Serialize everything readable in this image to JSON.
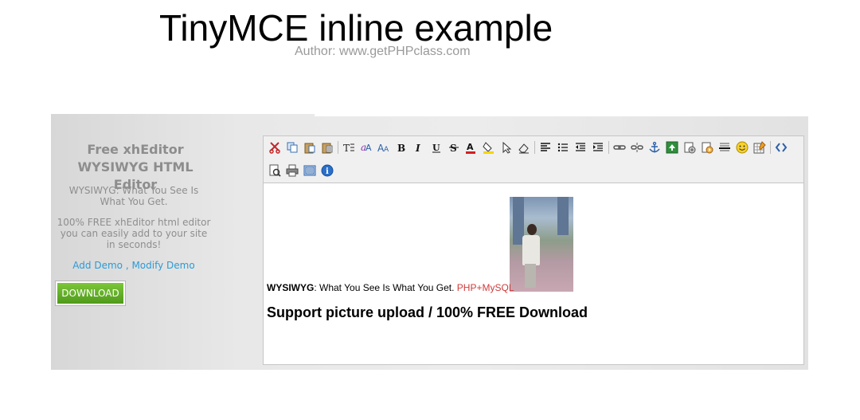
{
  "page": {
    "title": "TinyMCE inline example",
    "author": "Author: www.getPHPclass.com"
  },
  "sidebar": {
    "title_line1": "Free xhEditor",
    "title_line2": "WYSIWYG HTML Editor",
    "text1": "WYSIWYG: What You See Is What You Get.",
    "text2": "100% FREE xhEditor html editor you can easily add to your site in seconds!",
    "add_demo": "Add Demo",
    "separator": " , ",
    "modify_demo": "Modify Demo",
    "download": "DOWNLOAD"
  },
  "toolbar": {
    "row1": [
      "cut-icon",
      "copy-icon",
      "paste-icon",
      "paste-text-icon",
      "|",
      "font-size-icon",
      "font-family-icon",
      "font-color-a-icon",
      "bold-icon",
      "italic-icon",
      "underline-icon",
      "strikethrough-icon",
      "font-color-icon",
      "background-color-icon",
      "select-icon",
      "remove-format-icon",
      "|",
      "align-icon",
      "list-icon",
      "outdent-icon",
      "indent-icon",
      "|",
      "link-icon",
      "unlink-icon",
      "anchor-icon",
      "image-icon",
      "flash-icon",
      "media-icon",
      "horizontal-rule-icon",
      "emoticon-icon",
      "table-icon",
      "|",
      "source-icon"
    ],
    "row2": [
      "preview-icon",
      "print-icon",
      "fullscreen-icon",
      "about-icon"
    ]
  },
  "content": {
    "bold_prefix": "WYSIWYG",
    "line1_rest": ": What You See Is What You Get. ",
    "red_text": "PHP+MySQL",
    "heading": "Support picture upload / 100% FREE Download"
  },
  "colors": {
    "link": "#2c9bd6",
    "download_green": "#5fa624",
    "red_text": "#d03a3a",
    "panel_bg": "#e6e6e6"
  }
}
